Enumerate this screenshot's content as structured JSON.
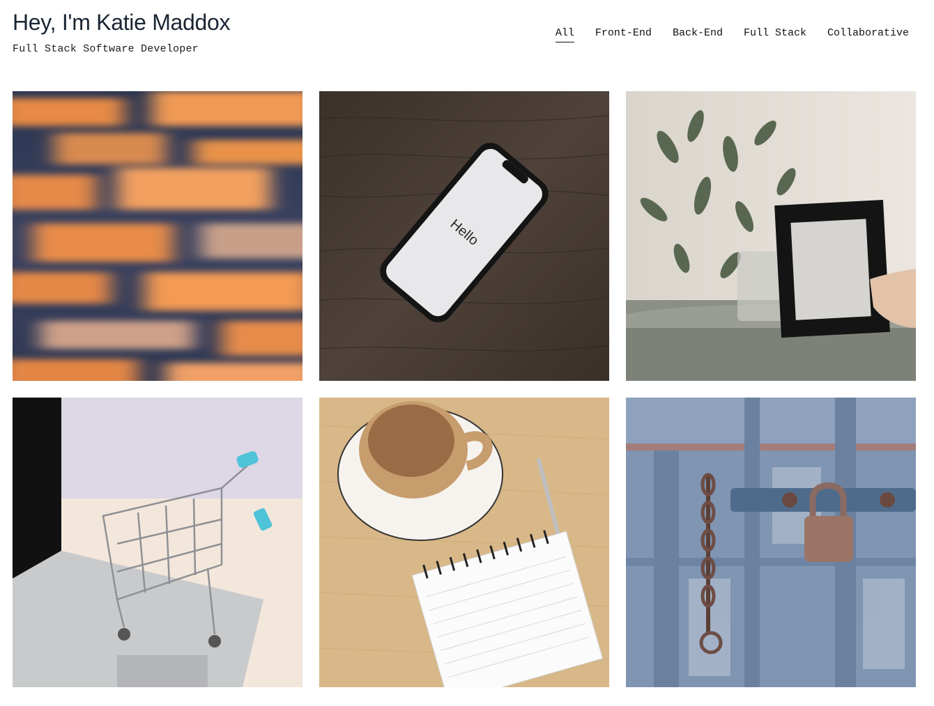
{
  "header": {
    "title": "Hey, I'm Katie Maddox",
    "subtitle": "Full Stack Software Developer"
  },
  "nav": {
    "items": [
      {
        "label": "All",
        "active": true
      },
      {
        "label": "Front-End",
        "active": false
      },
      {
        "label": "Back-End",
        "active": false
      },
      {
        "label": "Full Stack",
        "active": false
      },
      {
        "label": "Collaborative",
        "active": false
      }
    ]
  },
  "projects": [
    {
      "image": "blurred-orange-navy-abstract"
    },
    {
      "image": "smartphone-on-wood",
      "screen_text": "Hello"
    },
    {
      "image": "eucalyptus-and-frame"
    },
    {
      "image": "shopping-cart-on-laptop"
    },
    {
      "image": "coffee-and-notepad"
    },
    {
      "image": "padlock-on-blue-door"
    }
  ],
  "colors": {
    "title": "#1a2634",
    "text": "#111111"
  }
}
